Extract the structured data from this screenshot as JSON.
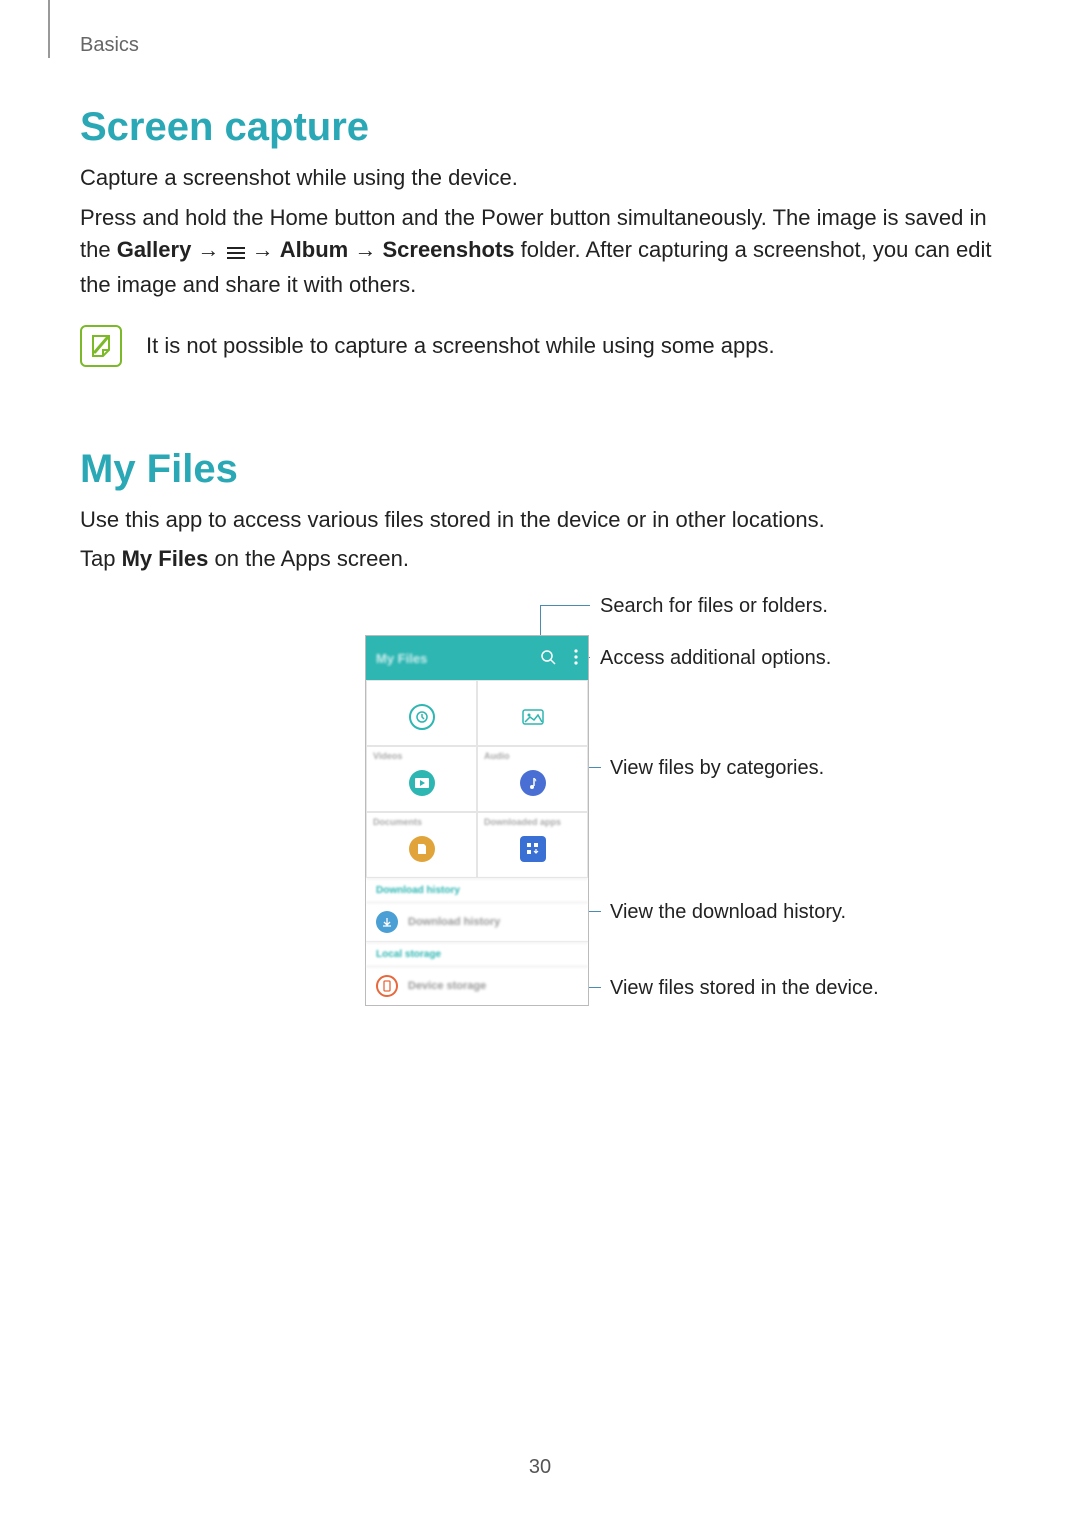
{
  "breadcrumb": "Basics",
  "section1": {
    "heading": "Screen capture",
    "p1": "Capture a screenshot while using the device.",
    "p2_a": "Press and hold the Home button and the Power button simultaneously. The image is saved in the ",
    "p2_b_gallery": "Gallery",
    "p2_arrow": " → ",
    "p2_c_album": "Album",
    "p2_d_screenshots": "Screenshots",
    "p2_e": " folder. After capturing a screenshot, you can edit the image and share it with others.",
    "note": "It is not possible to capture a screenshot while using some apps."
  },
  "section2": {
    "heading": "My Files",
    "p1": "Use this app to access various files stored in the device or in other locations.",
    "p2_a": "Tap ",
    "p2_b_myfiles": "My Files",
    "p2_c": " on the Apps screen."
  },
  "phone": {
    "title": "My Files",
    "categories": {
      "row1a": "",
      "row1b": "",
      "row2a": "Videos",
      "row2b": "Audio",
      "row3a": "Documents",
      "row3b": "Downloaded apps"
    },
    "sectionA": "Download history",
    "listA": "Download history",
    "sectionB": "Local storage",
    "listB": "Device storage"
  },
  "callouts": {
    "search": "Search for files or folders.",
    "options": "Access additional options.",
    "categories": "View files by categories.",
    "download": "View the download history.",
    "device": "View files stored in the device."
  },
  "page_number": "30"
}
